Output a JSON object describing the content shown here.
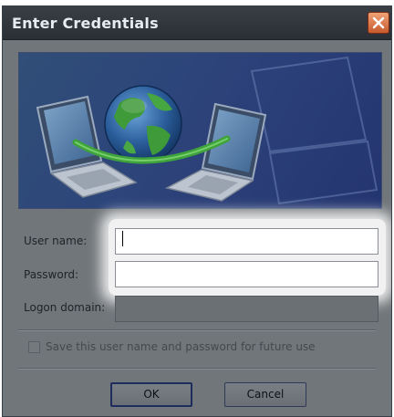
{
  "dialog": {
    "title": "Enter Credentials"
  },
  "form": {
    "username_label": "User name:",
    "username_value": "",
    "password_label": "Password:",
    "password_value": "",
    "domain_label": "Logon domain:",
    "domain_value": "",
    "save_checkbox_label": "Save this user name and password for future use",
    "save_checked": false
  },
  "buttons": {
    "ok_label": "OK",
    "cancel_label": "Cancel"
  },
  "icons": {
    "close": "close-icon",
    "banner": "network-globe-laptops-illustration"
  },
  "colors": {
    "titlebar": "#2f343b",
    "close_button": "#d9683a",
    "banner_blue": "#2d467a",
    "dialog_bg": "#71767a"
  }
}
